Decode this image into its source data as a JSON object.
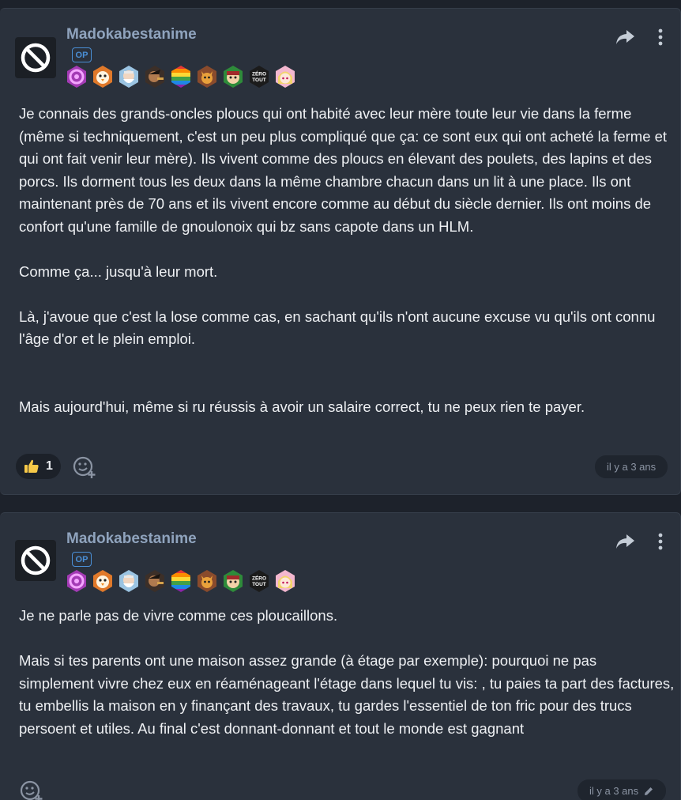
{
  "posts": [
    {
      "username": "Madokabestanime",
      "op_label": "OP",
      "avatar_icon": "no-entry-icon",
      "badges": [
        "swirl-badge",
        "chick-badge",
        "elder-badge",
        "warrior-badge",
        "rainbow-badge",
        "fox-badge",
        "goblin-badge",
        "zero-tout-badge",
        "anime-girl-badge"
      ],
      "zero_tout_text": "ZÉRO TOUT",
      "paragraphs": [
        "Je connais des grands-oncles ploucs qui ont habité avec leur mère toute leur vie dans la ferme (même si techniquement, c'est un peu plus compliqué que ça: ce sont eux qui ont acheté la ferme et qui ont fait venir leur mère). Ils vivent comme des ploucs en élevant des poulets, des lapins et des porcs. Ils dorment tous les deux dans la même chambre chacun dans un lit à une place. Ils ont maintenant près de 70 ans et ils vivent encore comme au début du siècle dernier. Ils ont moins de confort qu'une famille de gnoulonoix qui bz sans capote dans un HLM.",
        "Comme ça... jusqu'à leur mort.",
        "Là, j'avoue que c'est la lose comme cas, en sachant qu'ils n'ont aucune excuse vu qu'ils ont connu l'âge d'or et le plein emploi.",
        "Mais aujourd'hui, même si ru réussis à avoir un salaire correct, tu ne peux rien te payer."
      ],
      "like_count": "1",
      "timestamp": "il y a 3 ans"
    },
    {
      "username": "Madokabestanime",
      "op_label": "OP",
      "avatar_icon": "no-entry-icon",
      "badges": [
        "swirl-badge",
        "chick-badge",
        "elder-badge",
        "warrior-badge",
        "rainbow-badge",
        "fox-badge",
        "goblin-badge",
        "zero-tout-badge",
        "anime-girl-badge"
      ],
      "zero_tout_text": "ZÉRO TOUT",
      "paragraphs": [
        "Je ne parle pas de vivre comme ces ploucaillons.",
        "Mais si tes parents ont une maison assez grande (à étage par exemple): pourquoi ne pas simplement vivre chez eux en réaménageant l'étage dans lequel tu vis: , tu paies ta part des factures, tu embellis la maison en y finançant des travaux, tu gardes l'essentiel de ton fric pour des trucs persoent et utiles. Au final c'est donnant-donnant et tout le monde est gagnant"
      ],
      "timestamp": "il y a 3 ans",
      "edited": true
    }
  ],
  "colors": {
    "background": "#1d222b",
    "card": "#2a313c",
    "username": "#8fa3bd",
    "op_badge": "#4a8fd6",
    "text": "#eef0f3",
    "muted": "#8b94a3"
  }
}
